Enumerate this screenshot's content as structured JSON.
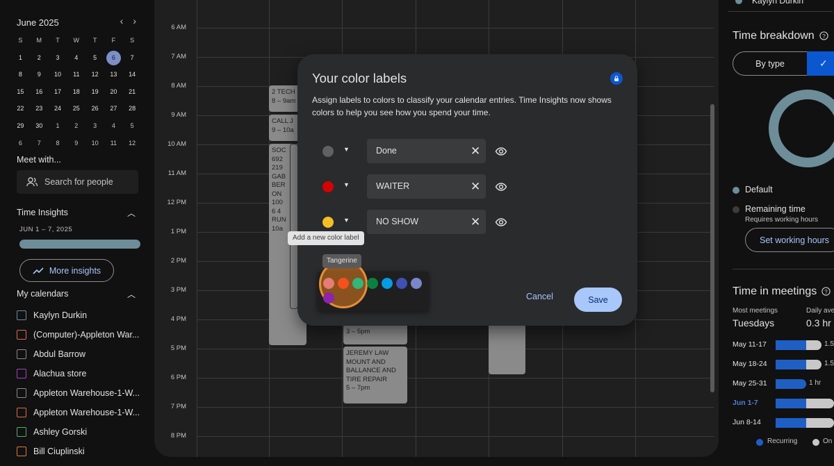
{
  "mini_calendar": {
    "title": "June 2025",
    "prev": "‹",
    "next": "›",
    "dow": [
      "S",
      "M",
      "T",
      "W",
      "T",
      "F",
      "S"
    ],
    "weeks": [
      [
        "1",
        "2",
        "3",
        "4",
        "5",
        "6",
        "7"
      ],
      [
        "8",
        "9",
        "10",
        "11",
        "12",
        "13",
        "14"
      ],
      [
        "15",
        "16",
        "17",
        "18",
        "19",
        "20",
        "21"
      ],
      [
        "22",
        "23",
        "24",
        "25",
        "26",
        "27",
        "28"
      ],
      [
        "29",
        "30",
        "1",
        "2",
        "3",
        "4",
        "5"
      ],
      [
        "6",
        "7",
        "8",
        "9",
        "10",
        "11",
        "12"
      ]
    ],
    "today": "6"
  },
  "meet_with": {
    "title": "Meet with...",
    "placeholder": "Search for people"
  },
  "time_insights": {
    "title": "Time Insights",
    "range": "JUN 1 – 7, 2025",
    "more_label": "More insights"
  },
  "my_calendars": {
    "title": "My calendars",
    "items": [
      {
        "name": "Kaylyn Durkin",
        "color": "#6d8d99"
      },
      {
        "name": "(Computer)-Appleton War...",
        "color": "#e06b4f"
      },
      {
        "name": "Abdul Barrow",
        "color": "#8a8a8a"
      },
      {
        "name": "Alachua store",
        "color": "#a142c8"
      },
      {
        "name": "Appleton Warehouse-1-W...",
        "color": "#8a8a8a"
      },
      {
        "name": "Appleton Warehouse-1-W...",
        "color": "#e06b4f"
      },
      {
        "name": "Ashley Gorski",
        "color": "#4caf6e"
      },
      {
        "name": "Bill Ciuplinski",
        "color": "#e07b2f"
      }
    ]
  },
  "calendar": {
    "hours": [
      "6 AM",
      "7 AM",
      "8 AM",
      "9 AM",
      "10 AM",
      "11 AM",
      "12 PM",
      "1 PM",
      "2 PM",
      "3 PM",
      "4 PM",
      "5 PM",
      "6 PM",
      "7 PM",
      "8 PM"
    ],
    "events": {
      "e1": "2 TECH\n8 – 9am",
      "e2": "CALL J\n9 – 10a",
      "e3": "SOC\n692\n219\nGAB\nBER\nON\n100\n6 4\nRUN\n10a",
      "e4": "3 – 5pm",
      "e5": "JEREMY LAW\nMOUNT AND\nBALLANCE AND\nTIRE REPAIR\n5 – 7pm"
    }
  },
  "right_panel": {
    "top_name": "Kaylyn Durkin",
    "breakdown_title": "Time breakdown",
    "by_type": "By type",
    "check": "✓",
    "legend_default": "Default",
    "legend_remaining": "Remaining time",
    "requires": "Requires working hours",
    "set_hours": "Set working hours",
    "meetings_title": "Time in meetings",
    "most_meetings_label": "Most meetings",
    "most_meetings_value": "Tuesdays",
    "daily_label": "Daily ave",
    "daily_value": "0.3 hr",
    "weeks": [
      {
        "label": "May 11-17",
        "value_text": "1.5",
        "blue": 44,
        "grey": 22
      },
      {
        "label": "May 18-24",
        "value_text": "1.5",
        "blue": 44,
        "grey": 22
      },
      {
        "label": "May 25-31",
        "value_text": "1 hr",
        "blue": 44,
        "grey": 0
      },
      {
        "label": "Jun 1-7",
        "value_text": "",
        "blue": 44,
        "grey": 40
      },
      {
        "label": "Jun 8-14",
        "value_text": "",
        "blue": 44,
        "grey": 40
      }
    ],
    "legend_recurring": "Recurring",
    "legend_one": "On"
  },
  "modal": {
    "title": "Your color labels",
    "description": "Assign labels to colors to classify your calendar entries. Time Insights now shows colors to help you see how you spend your time.",
    "labels": [
      {
        "color": "#616161",
        "value": "Done"
      },
      {
        "color": "#d50000",
        "value": "WAITER"
      },
      {
        "color": "#f6bf26",
        "value": "NO SHOW"
      }
    ],
    "tooltip": "Add a new color label",
    "swatch_tooltip": "Tangerine",
    "palette": [
      "#e67c73",
      "#f4511e",
      "#33b679",
      "#0b8043",
      "#039be5",
      "#3f51b5",
      "#7986cb",
      "#8e24aa"
    ],
    "cancel": "Cancel",
    "save": "Save"
  }
}
